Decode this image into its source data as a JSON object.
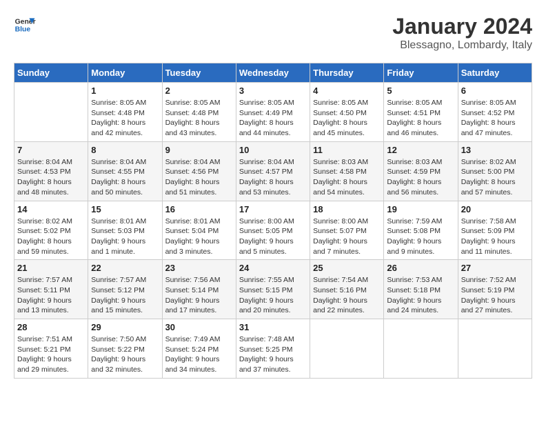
{
  "logo": {
    "line1": "General",
    "line2": "Blue"
  },
  "title": "January 2024",
  "location": "Blessagno, Lombardy, Italy",
  "days_of_week": [
    "Sunday",
    "Monday",
    "Tuesday",
    "Wednesday",
    "Thursday",
    "Friday",
    "Saturday"
  ],
  "weeks": [
    [
      {
        "day": "",
        "info": ""
      },
      {
        "day": "1",
        "info": "Sunrise: 8:05 AM\nSunset: 4:48 PM\nDaylight: 8 hours\nand 42 minutes."
      },
      {
        "day": "2",
        "info": "Sunrise: 8:05 AM\nSunset: 4:48 PM\nDaylight: 8 hours\nand 43 minutes."
      },
      {
        "day": "3",
        "info": "Sunrise: 8:05 AM\nSunset: 4:49 PM\nDaylight: 8 hours\nand 44 minutes."
      },
      {
        "day": "4",
        "info": "Sunrise: 8:05 AM\nSunset: 4:50 PM\nDaylight: 8 hours\nand 45 minutes."
      },
      {
        "day": "5",
        "info": "Sunrise: 8:05 AM\nSunset: 4:51 PM\nDaylight: 8 hours\nand 46 minutes."
      },
      {
        "day": "6",
        "info": "Sunrise: 8:05 AM\nSunset: 4:52 PM\nDaylight: 8 hours\nand 47 minutes."
      }
    ],
    [
      {
        "day": "7",
        "info": "Sunrise: 8:04 AM\nSunset: 4:53 PM\nDaylight: 8 hours\nand 48 minutes."
      },
      {
        "day": "8",
        "info": "Sunrise: 8:04 AM\nSunset: 4:55 PM\nDaylight: 8 hours\nand 50 minutes."
      },
      {
        "day": "9",
        "info": "Sunrise: 8:04 AM\nSunset: 4:56 PM\nDaylight: 8 hours\nand 51 minutes."
      },
      {
        "day": "10",
        "info": "Sunrise: 8:04 AM\nSunset: 4:57 PM\nDaylight: 8 hours\nand 53 minutes."
      },
      {
        "day": "11",
        "info": "Sunrise: 8:03 AM\nSunset: 4:58 PM\nDaylight: 8 hours\nand 54 minutes."
      },
      {
        "day": "12",
        "info": "Sunrise: 8:03 AM\nSunset: 4:59 PM\nDaylight: 8 hours\nand 56 minutes."
      },
      {
        "day": "13",
        "info": "Sunrise: 8:02 AM\nSunset: 5:00 PM\nDaylight: 8 hours\nand 57 minutes."
      }
    ],
    [
      {
        "day": "14",
        "info": "Sunrise: 8:02 AM\nSunset: 5:02 PM\nDaylight: 8 hours\nand 59 minutes."
      },
      {
        "day": "15",
        "info": "Sunrise: 8:01 AM\nSunset: 5:03 PM\nDaylight: 9 hours\nand 1 minute."
      },
      {
        "day": "16",
        "info": "Sunrise: 8:01 AM\nSunset: 5:04 PM\nDaylight: 9 hours\nand 3 minutes."
      },
      {
        "day": "17",
        "info": "Sunrise: 8:00 AM\nSunset: 5:05 PM\nDaylight: 9 hours\nand 5 minutes."
      },
      {
        "day": "18",
        "info": "Sunrise: 8:00 AM\nSunset: 5:07 PM\nDaylight: 9 hours\nand 7 minutes."
      },
      {
        "day": "19",
        "info": "Sunrise: 7:59 AM\nSunset: 5:08 PM\nDaylight: 9 hours\nand 9 minutes."
      },
      {
        "day": "20",
        "info": "Sunrise: 7:58 AM\nSunset: 5:09 PM\nDaylight: 9 hours\nand 11 minutes."
      }
    ],
    [
      {
        "day": "21",
        "info": "Sunrise: 7:57 AM\nSunset: 5:11 PM\nDaylight: 9 hours\nand 13 minutes."
      },
      {
        "day": "22",
        "info": "Sunrise: 7:57 AM\nSunset: 5:12 PM\nDaylight: 9 hours\nand 15 minutes."
      },
      {
        "day": "23",
        "info": "Sunrise: 7:56 AM\nSunset: 5:14 PM\nDaylight: 9 hours\nand 17 minutes."
      },
      {
        "day": "24",
        "info": "Sunrise: 7:55 AM\nSunset: 5:15 PM\nDaylight: 9 hours\nand 20 minutes."
      },
      {
        "day": "25",
        "info": "Sunrise: 7:54 AM\nSunset: 5:16 PM\nDaylight: 9 hours\nand 22 minutes."
      },
      {
        "day": "26",
        "info": "Sunrise: 7:53 AM\nSunset: 5:18 PM\nDaylight: 9 hours\nand 24 minutes."
      },
      {
        "day": "27",
        "info": "Sunrise: 7:52 AM\nSunset: 5:19 PM\nDaylight: 9 hours\nand 27 minutes."
      }
    ],
    [
      {
        "day": "28",
        "info": "Sunrise: 7:51 AM\nSunset: 5:21 PM\nDaylight: 9 hours\nand 29 minutes."
      },
      {
        "day": "29",
        "info": "Sunrise: 7:50 AM\nSunset: 5:22 PM\nDaylight: 9 hours\nand 32 minutes."
      },
      {
        "day": "30",
        "info": "Sunrise: 7:49 AM\nSunset: 5:24 PM\nDaylight: 9 hours\nand 34 minutes."
      },
      {
        "day": "31",
        "info": "Sunrise: 7:48 AM\nSunset: 5:25 PM\nDaylight: 9 hours\nand 37 minutes."
      },
      {
        "day": "",
        "info": ""
      },
      {
        "day": "",
        "info": ""
      },
      {
        "day": "",
        "info": ""
      }
    ]
  ]
}
